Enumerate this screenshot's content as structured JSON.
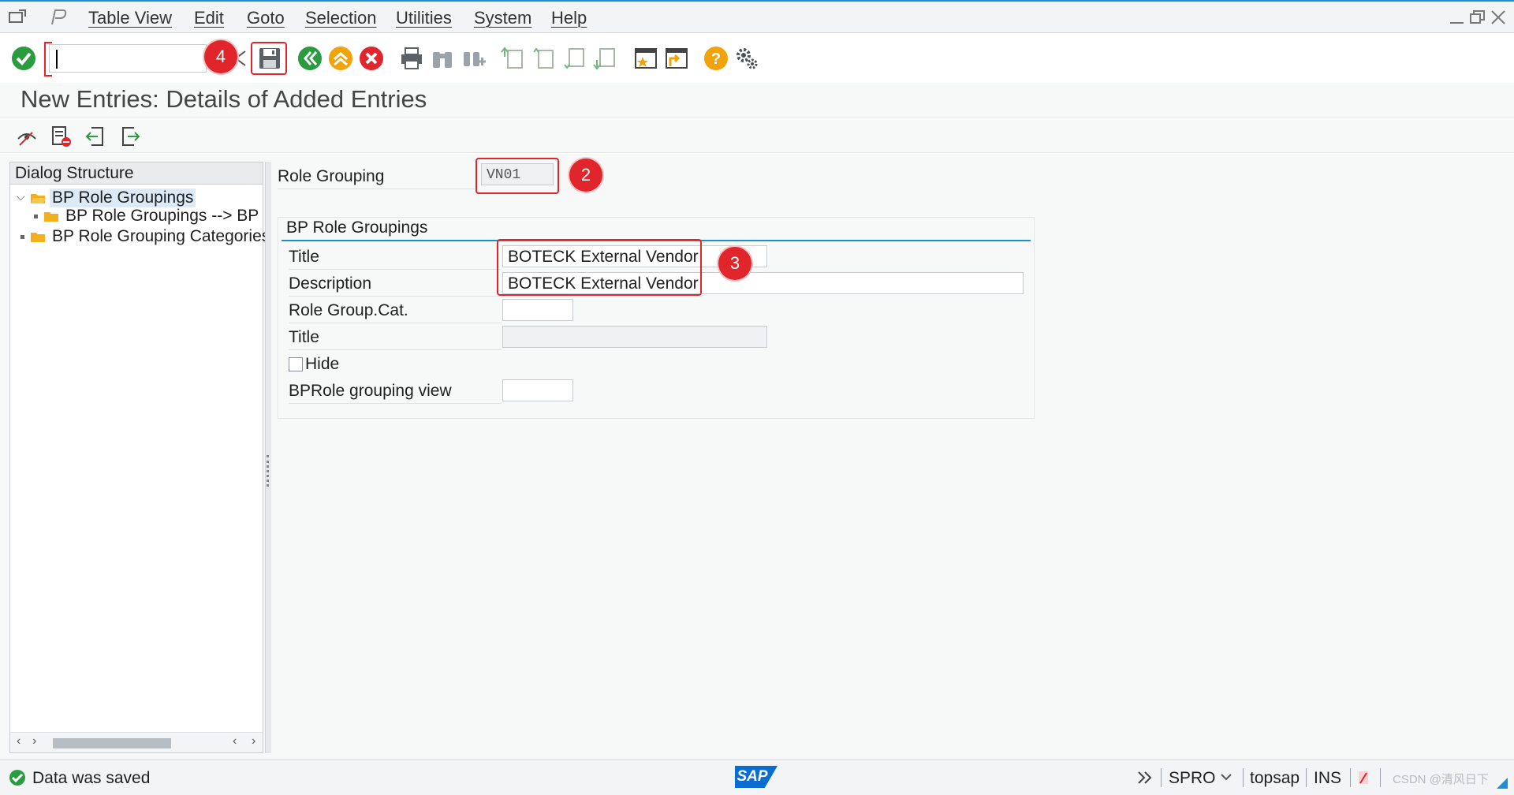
{
  "menu": {
    "items": [
      "Table View",
      "Edit",
      "Goto",
      "Selection",
      "Utilities",
      "System",
      "Help"
    ]
  },
  "toolbar": {
    "command_field_value": "",
    "icons": [
      "enter-icon",
      "save-icon",
      "back-icon",
      "exit-icon",
      "cancel-icon",
      "print-icon",
      "find-icon",
      "find-next-icon",
      "first-page-icon",
      "previous-page-icon",
      "next-page-icon",
      "last-page-icon",
      "create-session-icon",
      "shortcut-icon",
      "help-icon",
      "customize-layout-icon"
    ]
  },
  "page": {
    "title": "New Entries: Details of Added Entries"
  },
  "dialog_structure": {
    "header": "Dialog Structure",
    "nodes": [
      {
        "label": "BP Role Groupings",
        "selected": true,
        "expanded": true
      },
      {
        "label": "BP Role Groupings --> BP",
        "selected": false
      },
      {
        "label": "BP Role Grouping Categories",
        "selected": false
      }
    ]
  },
  "form": {
    "role_grouping_label": "Role Grouping",
    "role_grouping_value": "VN01",
    "group_title": "BP Role Groupings",
    "title_label": "Title",
    "title_value": "BOTECK External Vendor",
    "description_label": "Description",
    "description_value": "BOTECK External Vendor",
    "role_group_cat_label": "Role Group.Cat.",
    "role_group_cat_value": "",
    "cat_title_label": "Title",
    "cat_title_value": "",
    "hide_label": "Hide",
    "hide_checked": false,
    "bprole_view_label": "BPRole grouping view",
    "bprole_view_value": ""
  },
  "annotations": {
    "badge_2": "2",
    "badge_3": "3",
    "badge_4": "4"
  },
  "status": {
    "message": "Data was saved",
    "system": "SPRO",
    "client": "topsap",
    "mode": "INS",
    "watermark": "CSDN @清风日下"
  },
  "colors": {
    "accent": "#1a8fd7",
    "annotation_red": "#e0252b",
    "success_green": "#2b9b3f",
    "sap_blue": "#0a6ed1"
  }
}
